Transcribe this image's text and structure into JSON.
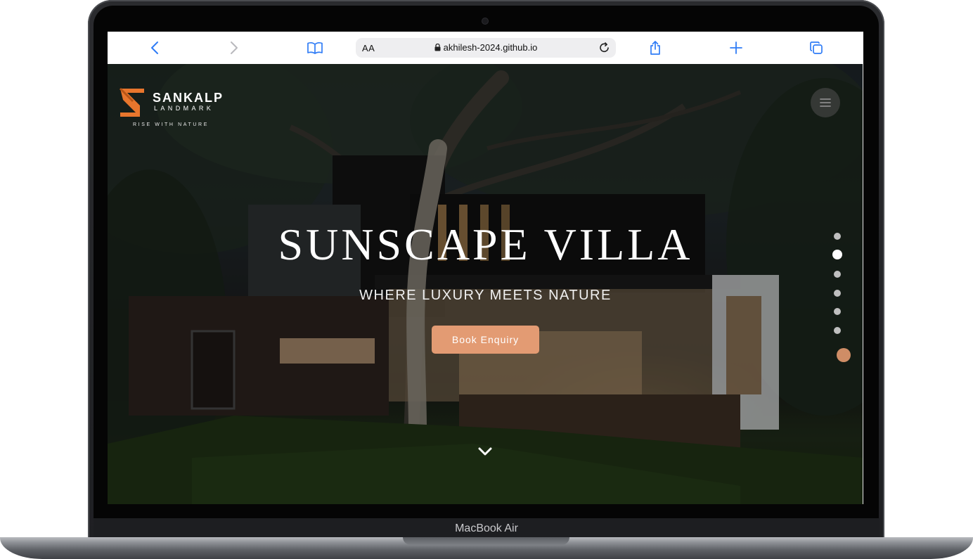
{
  "device": {
    "label": "MacBook Air"
  },
  "browser": {
    "text_size_label": "AA",
    "url": "akhilesh-2024.github.io"
  },
  "site": {
    "logo": {
      "name": "SANKALP",
      "sub": "LANDMARK",
      "tagline": "RISE WITH NATURE"
    },
    "hero": {
      "title": "SUNSCAPE VILLA",
      "subtitle": "WHERE LUXURY MEETS NATURE",
      "cta_label": "Book Enquiry"
    },
    "slide_dots": {
      "count": 6,
      "active_index": 1
    },
    "colors": {
      "accent": "#e39b73",
      "logo_orange": "#e8762d"
    }
  }
}
